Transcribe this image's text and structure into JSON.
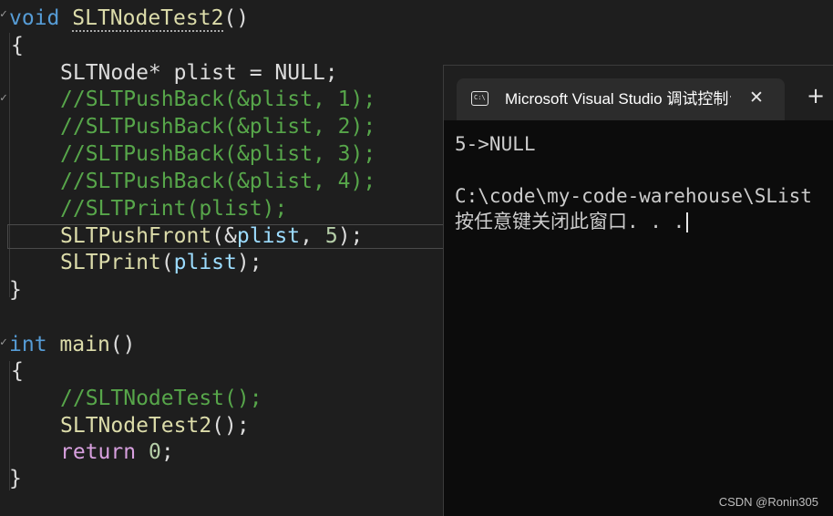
{
  "editor": {
    "lines": {
      "l1_kw": "void",
      "l1_fn": "SLTNodeTest2",
      "l1_paren": "()",
      "l2": "{",
      "l3_type": "SLTNode*",
      "l3_rest": " plist = NULL;",
      "l4": "//SLTPushBack(&plist, 1);",
      "l5": "//SLTPushBack(&plist, 2);",
      "l6": "//SLTPushBack(&plist, 3);",
      "l7": "//SLTPushBack(&plist, 4);",
      "l8": "//SLTPrint(plist);",
      "l9_fn": "SLTPushFront",
      "l9_a": "(&",
      "l9_var": "plist",
      "l9_b": ", ",
      "l9_num": "5",
      "l9_c": ");",
      "l10_fn": "SLTPrint",
      "l10_a": "(",
      "l10_var": "plist",
      "l10_b": ");",
      "l11": "}",
      "l13_kw": "int",
      "l13_fn": "main",
      "l13_paren": "()",
      "l14": "{",
      "l15": "//SLTNodeTest();",
      "l16_fn": "SLTNodeTest2",
      "l16_rest": "();",
      "l17_kw": "return",
      "l17_num": "0",
      "l17_rest": ";",
      "l18": "}"
    },
    "fold_glyph": "✓"
  },
  "terminal": {
    "tab_icon_text": "C:\\",
    "tab_title": "Microsoft Visual Studio 调试控制台",
    "tab_close": "✕",
    "tab_new": "+",
    "output_line1": "5->NULL",
    "output_line2": "C:\\code\\my-code-warehouse\\SList",
    "output_line3": "按任意键关闭此窗口. . ."
  },
  "watermark": "CSDN @Ronin305",
  "colors": {
    "keyword": "#569cd6",
    "control_keyword": "#d8a0df",
    "function": "#dcdcaa",
    "comment": "#57a64a",
    "number": "#b5cea8",
    "variable": "#9cdcfe"
  }
}
